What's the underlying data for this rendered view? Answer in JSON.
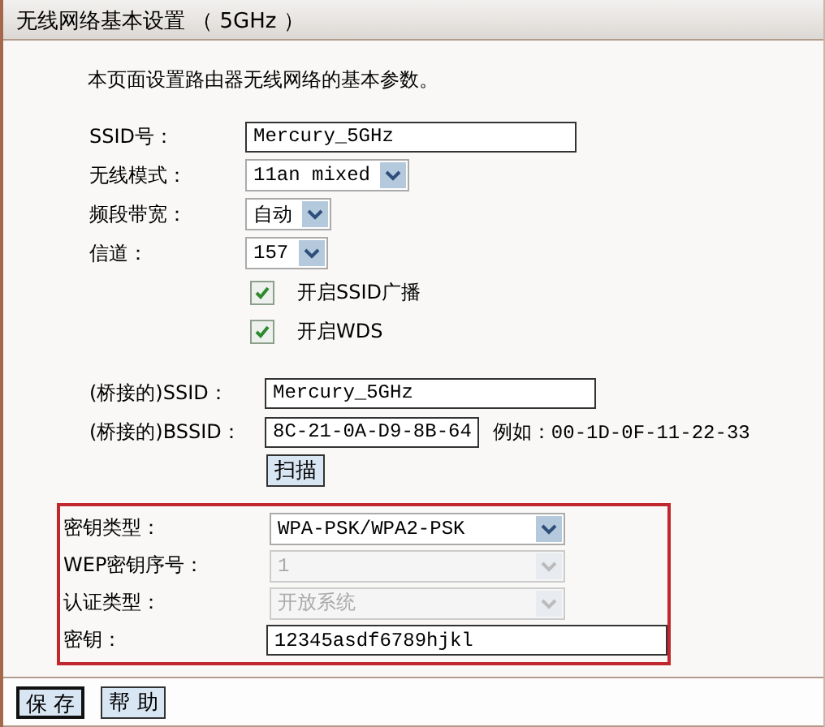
{
  "panel": {
    "title": "无线网络基本设置 （ 5GHz ）"
  },
  "intro": "本页面设置路由器无线网络的基本参数。",
  "basic": [
    {
      "kind": "text",
      "label": "SSID号：",
      "value": "Mercury_5GHz"
    },
    {
      "kind": "select",
      "label": "无线模式：",
      "value": "11an mixed"
    },
    {
      "kind": "select",
      "label": "频段带宽：",
      "value": "自动"
    },
    {
      "kind": "select",
      "label": "信道：",
      "value": "157"
    }
  ],
  "checkboxes": [
    {
      "label": "开启SSID广播",
      "checked": true
    },
    {
      "label": "开启WDS",
      "checked": true
    }
  ],
  "bridge": [
    {
      "label": "(桥接的)SSID：",
      "value": "Mercury_5GHz"
    },
    {
      "label": "(桥接的)BSSID：",
      "value": "8C-21-0A-D9-8B-64",
      "hint": "例如：00-1D-0F-11-22-33"
    }
  ],
  "scan_button": "扫描",
  "security": {
    "highlighted": true,
    "rows": [
      {
        "kind": "select",
        "label": "密钥类型：",
        "value": "WPA-PSK/WPA2-PSK",
        "disabled": false
      },
      {
        "kind": "select",
        "label": "WEP密钥序号：",
        "value": "1",
        "disabled": true
      },
      {
        "kind": "select",
        "label": "认证类型：",
        "value": "开放系统",
        "disabled": true
      },
      {
        "kind": "text",
        "label": "密钥：",
        "value": "12345asdf6789hjkl",
        "disabled": false
      }
    ]
  },
  "buttons": [
    {
      "label": "保 存",
      "focused": true
    },
    {
      "label": "帮 助",
      "focused": false
    }
  ]
}
